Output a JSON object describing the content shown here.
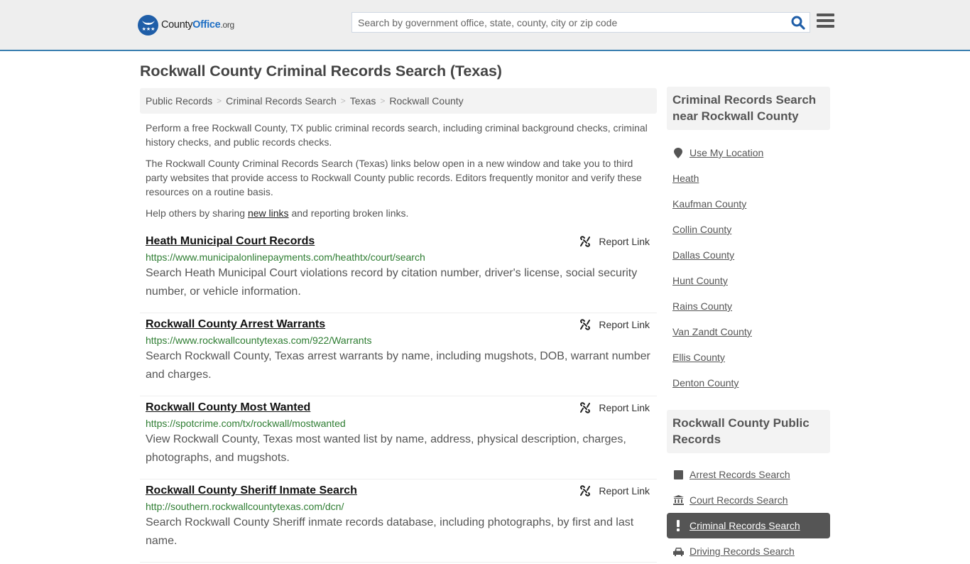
{
  "header": {
    "logo": {
      "county": "County",
      "office": "Office",
      "org": ".org"
    },
    "search_placeholder": "Search by government office, state, county, city or zip code",
    "search_icon": "search-icon",
    "menu_icon": "hamburger-menu-icon"
  },
  "page_title": "Rockwall County Criminal Records Search (Texas)",
  "breadcrumb": [
    {
      "label": "Public Records"
    },
    {
      "label": "Criminal Records Search"
    },
    {
      "label": "Texas"
    },
    {
      "label": "Rockwall County"
    }
  ],
  "intro": {
    "p1": "Perform a free Rockwall County, TX public criminal records search, including criminal background checks, criminal history checks, and public records checks.",
    "p2": "The Rockwall County Criminal Records Search (Texas) links below open in a new window and take you to third party websites that provide access to Rockwall County public records. Editors frequently monitor and verify these resources on a routine basis.",
    "p3_before": "Help others by sharing ",
    "p3_link": "new links",
    "p3_after": " and reporting broken links."
  },
  "results": [
    {
      "title": "Heath Municipal Court Records",
      "url": "https://www.municipalonlinepayments.com/heathtx/court/search",
      "description": "Search Heath Municipal Court violations record by citation number, driver's license, social security number, or vehicle information.",
      "report_label": "Report Link"
    },
    {
      "title": "Rockwall County Arrest Warrants",
      "url": "https://www.rockwallcountytexas.com/922/Warrants",
      "description": "Search Rockwall County, Texas arrest warrants by name, including mugshots, DOB, warrant number and charges.",
      "report_label": "Report Link"
    },
    {
      "title": "Rockwall County Most Wanted",
      "url": "https://spotcrime.com/tx/rockwall/mostwanted",
      "description": "View Rockwall County, Texas most wanted list by name, address, physical description, charges, photographs, and mugshots.",
      "report_label": "Report Link"
    },
    {
      "title": "Rockwall County Sheriff Inmate Search",
      "url": "http://southern.rockwallcountytexas.com/dcn/",
      "description": "Search Rockwall County Sheriff inmate records database, including photographs, by first and last name.",
      "report_label": "Report Link"
    }
  ],
  "sidebar": {
    "nearby_heading": "Criminal Records Search near Rockwall County",
    "use_location": "Use My Location",
    "nearby": [
      "Heath",
      "Kaufman County",
      "Collin County",
      "Dallas County",
      "Hunt County",
      "Rains County",
      "Van Zandt County",
      "Ellis County",
      "Denton County"
    ],
    "public_heading": "Rockwall County Public Records",
    "public_records": [
      {
        "label": "Arrest Records Search",
        "icon": "square-icon",
        "active": false
      },
      {
        "label": "Court Records Search",
        "icon": "courthouse-icon",
        "active": false
      },
      {
        "label": "Criminal Records Search",
        "icon": "exclamation-icon",
        "active": true
      },
      {
        "label": "Driving Records Search",
        "icon": "car-icon",
        "active": false
      }
    ]
  },
  "colors": {
    "brand_blue": "#1f5ea8",
    "header_border": "#3a7fb0",
    "url_green": "#2e7d32",
    "active_bg": "#555555"
  }
}
